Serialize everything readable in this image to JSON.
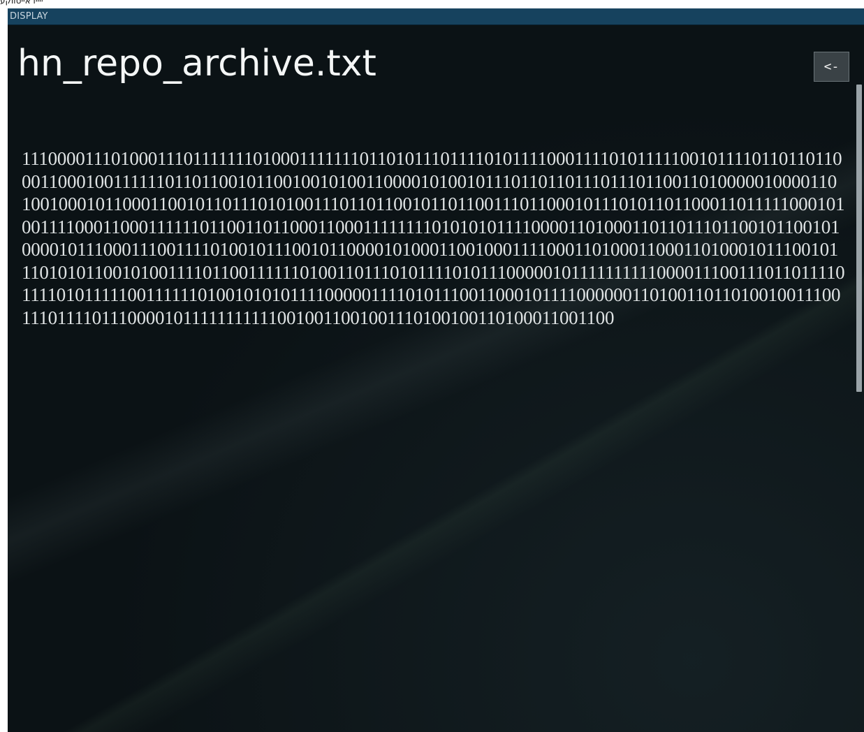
{
  "top_strip": {
    "text": "ייייו אייטווקע"
  },
  "window": {
    "title": "DISPLAY",
    "file_name": "hn_repo_archive.txt",
    "back_button_label": "<-",
    "content": "1110000111010001110111111101000111111101101011101111010111100011110101111100101111011011011000110001001111110110110010110010010100110000101001011101101101110111011001101000001000011010010001011000110010110111010100111011011001011011001110110001011101011011000110111110001010011110001100011111101100110110001100011111111010101011110000110100011011011101100101100101000010111000111001111010010111001011000010100011001000111100011010001100011010001011100101110101011001010011110110011111101001101110101111010111000001011111111110000111001110110111101111010111110011111101001010101111000001111010111001100010111100000011010011011010010011100111011110111000010111111111110010011001001110100100110100011001100"
  }
}
